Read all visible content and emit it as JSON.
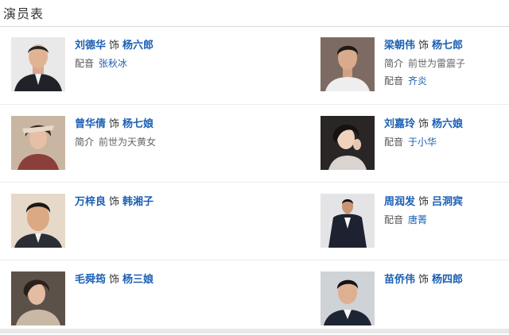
{
  "page": {
    "title": "演员表"
  },
  "cast": [
    {
      "actor": "刘德华",
      "role_word": "饰",
      "role": "杨六郎",
      "meta": [
        {
          "label": "配音",
          "value": "张秋冰",
          "link": true
        }
      ]
    },
    {
      "actor": "梁朝伟",
      "role_word": "饰",
      "role": "杨七郎",
      "meta": [
        {
          "label": "简介",
          "value": "前世为雷震子",
          "link": false
        },
        {
          "label": "配音",
          "value": "齐炎",
          "link": true
        }
      ]
    },
    {
      "actor": "曾华倩",
      "role_word": "饰",
      "role": "杨七娘",
      "meta": [
        {
          "label": "简介",
          "value": "前世为天黄女",
          "link": false
        }
      ]
    },
    {
      "actor": "刘嘉玲",
      "role_word": "饰",
      "role": "杨六娘",
      "meta": [
        {
          "label": "配音",
          "value": "于小华",
          "link": true
        }
      ]
    },
    {
      "actor": "万梓良",
      "role_word": "饰",
      "role": "韩湘子",
      "meta": []
    },
    {
      "actor": "周润发",
      "role_word": "饰",
      "role": "吕洞宾",
      "meta": [
        {
          "label": "配音",
          "value": "唐菁",
          "link": true
        }
      ]
    },
    {
      "actor": "毛舜筠",
      "role_word": "饰",
      "role": "杨三娘",
      "meta": []
    },
    {
      "actor": "苗侨伟",
      "role_word": "饰",
      "role": "杨四郎",
      "meta": []
    }
  ],
  "colors": {
    "link": "#1a5fb4",
    "divider": "#ececec"
  }
}
